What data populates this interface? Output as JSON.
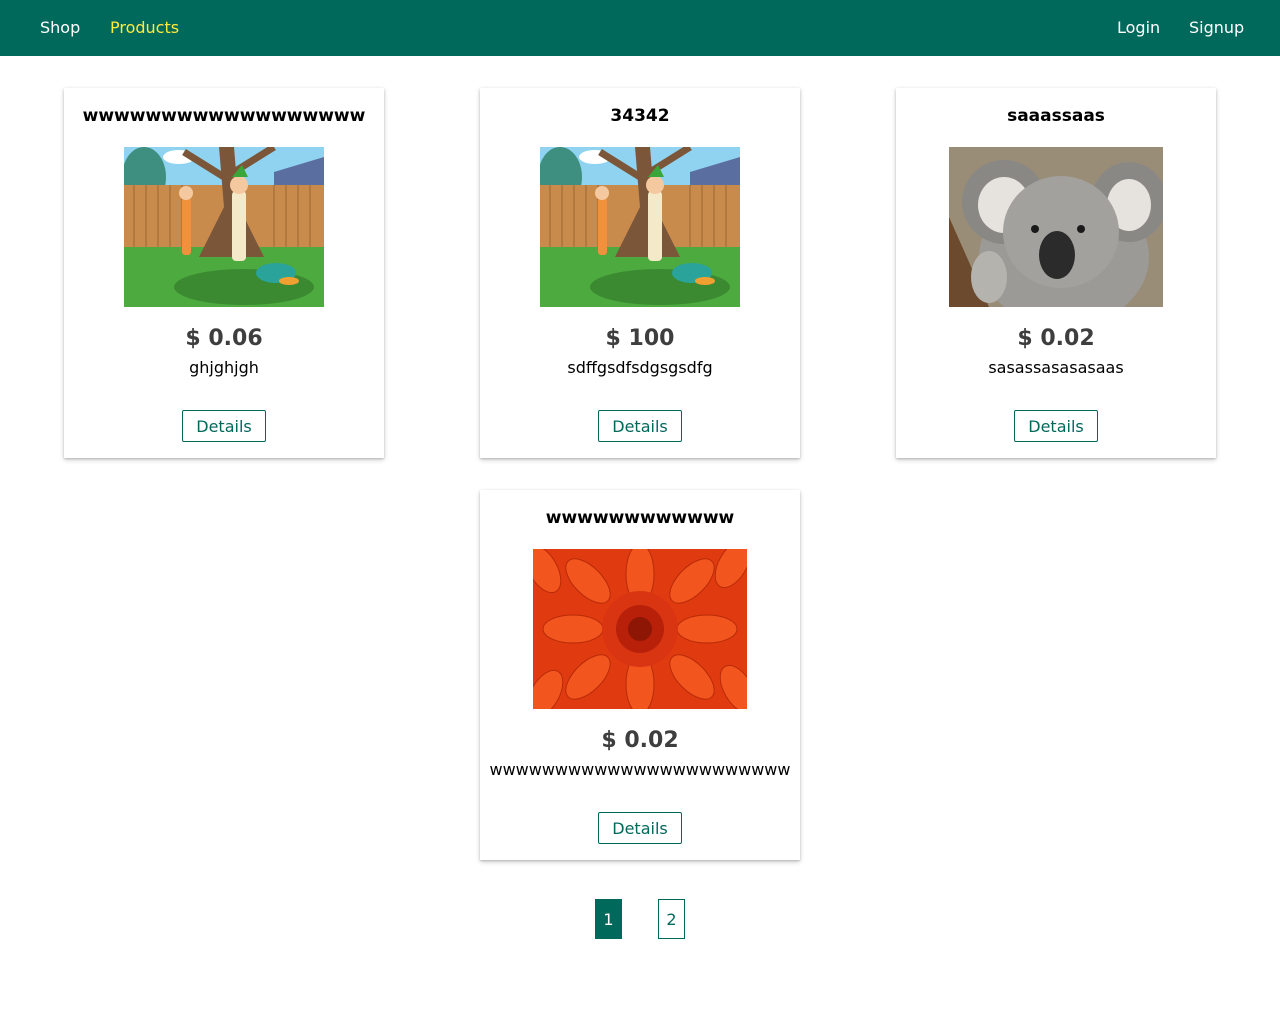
{
  "nav": {
    "shop": "Shop",
    "products": "Products",
    "login": "Login",
    "signup": "Signup",
    "active": "products"
  },
  "colors": {
    "primary": "#00695c",
    "active_nav": "#ffeb3b",
    "price": "#3e3e3e"
  },
  "products": [
    {
      "title": "wwwwwwwwwwwwwwwwww",
      "image": "cartoon-backyard-image",
      "price": "$ 0.06",
      "description": "ghjghjgh",
      "button": "Details"
    },
    {
      "title": "34342",
      "image": "cartoon-backyard-image",
      "price": "$ 100",
      "description": "sdffgsdfsdgsgsdfg",
      "button": "Details"
    },
    {
      "title": "saaassaas",
      "image": "koala-image",
      "price": "$ 0.02",
      "description": "sasassasasasaas",
      "button": "Details"
    },
    {
      "title": "wwwwwwwwwwww",
      "image": "orange-flower-image",
      "price": "$ 0.02",
      "description": "wwwwwwwwwwwwwwwwwwwwwww",
      "button": "Details"
    }
  ],
  "pagination": {
    "pages": [
      "1",
      "2"
    ],
    "current": "1"
  }
}
